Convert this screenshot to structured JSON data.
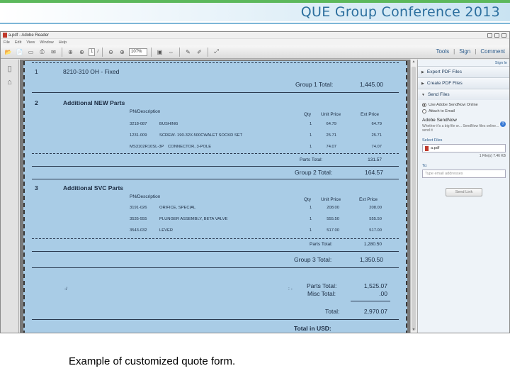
{
  "slide": {
    "conference_title": "QUE Group Conference 2013",
    "caption": "Example of customized quote form."
  },
  "window": {
    "title": "a.pdf - Adobe Reader",
    "menu": [
      "File",
      "Edit",
      "View",
      "Window",
      "Help"
    ],
    "toolbar": {
      "page_number": "1",
      "page_total": "/",
      "zoom": "107%",
      "tools": "Tools",
      "sign": "Sign",
      "comment": "Comment"
    }
  },
  "document": {
    "sections": [
      {
        "number": "1",
        "name": "8210-310 OH - Fixed",
        "group_total_label": "Group 1 Total:",
        "group_total_value": "1,445.00"
      },
      {
        "number": "2",
        "name": "Additional NEW Parts",
        "columns": [
          "PN/Description",
          "Qty",
          "Unit Price",
          "Ext Price"
        ],
        "rows": [
          {
            "pn": "3218-087",
            "desc": "BUSHING",
            "qty": "1",
            "unit": "64.79",
            "ext": "64.79"
          },
          {
            "pn": "1231-009",
            "desc": "SCREW- 190-32X.500CWALET SOCKD SET",
            "qty": "1",
            "unit": "25.71",
            "ext": "25.71"
          },
          {
            "pn": "MS3102R10SL-3P",
            "desc": "CONNECTOR, 3-POLE",
            "qty": "1",
            "unit": "74.07",
            "ext": "74.07"
          }
        ],
        "parts_total_label": "Parts Total:",
        "parts_total_value": "131.57",
        "group_total_label": "Group 2 Total:",
        "group_total_value": "164.57"
      },
      {
        "number": "3",
        "name": "Additional SVC Parts",
        "columns": [
          "PN/Description",
          "Qty",
          "Unit Price",
          "Ext Price"
        ],
        "rows": [
          {
            "pn": "3191-026",
            "desc": "ORIFICE, SPECIAL",
            "qty": "1",
            "unit": "208.00",
            "ext": "208.00"
          },
          {
            "pn": "3535-555",
            "desc": "PLUNGER ASSEMBLY, BETA VALVE",
            "qty": "1",
            "unit": "555.50",
            "ext": "555.50"
          },
          {
            "pn": "3543-032",
            "desc": "LEVER",
            "qty": "1",
            "unit": "517.00",
            "ext": "517.00"
          }
        ],
        "parts_total_label": "Parts Total:",
        "parts_total_value": "1,280.50",
        "group_total_label": "Group 3 Total:",
        "group_total_value": "1,350.50"
      }
    ],
    "summary": {
      "parts_total_label": "Parts Total:",
      "parts_total_value": "1,525.07",
      "misc_total_label": "Misc Total:",
      "misc_total_value": ".00",
      "total_label": "Total:",
      "total_value": "2,970.07",
      "total_usd_label": "Total in USD:"
    }
  },
  "right_panel": {
    "top_link": "Sign In",
    "panels": [
      {
        "label": "Export PDF Files",
        "state": "collapsed"
      },
      {
        "label": "Create PDF Files",
        "state": "collapsed"
      },
      {
        "label": "Send Files",
        "state": "expanded"
      }
    ],
    "send_files": {
      "option_1": "Use Adobe SendNow Online",
      "option_2": "Attach to Email",
      "service_title": "Adobe SendNow",
      "service_desc": "Whether it's a big file or... SendNow files online... send it",
      "files_label": "Select Files",
      "file_name": "a.pdf",
      "file_size": "1 File(s) 7.46 KB",
      "to_label": "To:",
      "to_placeholder": "Type email addresses",
      "send_button": "Send Link"
    }
  }
}
